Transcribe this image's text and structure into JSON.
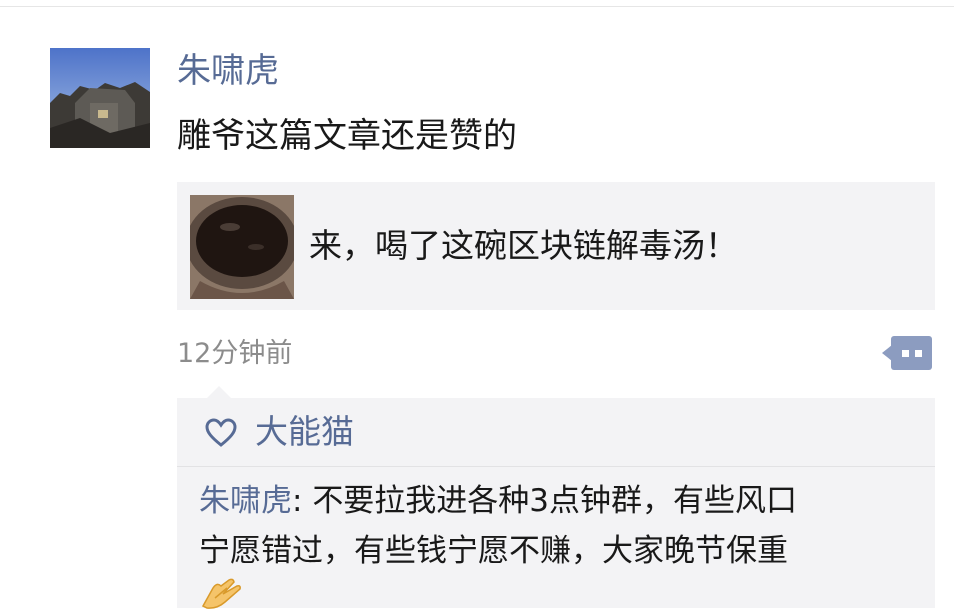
{
  "post": {
    "author": "朱啸虎",
    "text": "雕爷这篇文章还是赞的",
    "link_card": {
      "title": "来，喝了这碗区块链解毒汤！",
      "thumbnail_icon": "soup-bowl-thumbnail"
    },
    "time": "12分钟前",
    "more_icon": "comment-more-icon"
  },
  "interactions": {
    "likes": {
      "icon": "heart-icon",
      "names": "大能猫"
    },
    "comments": [
      {
        "author": "朱啸虎",
        "separator": ": ",
        "line1": "不要拉我进各种3点钟群，有些风口",
        "line2": "宁愿错过，有些钱宁愿不赚，大家晚节保重",
        "emoji": "clap-hands-emoji"
      }
    ]
  },
  "colors": {
    "name_link": "#576b95",
    "body_text": "#191919",
    "meta_text": "#8c8c8c",
    "card_bg": "#f3f3f5"
  }
}
